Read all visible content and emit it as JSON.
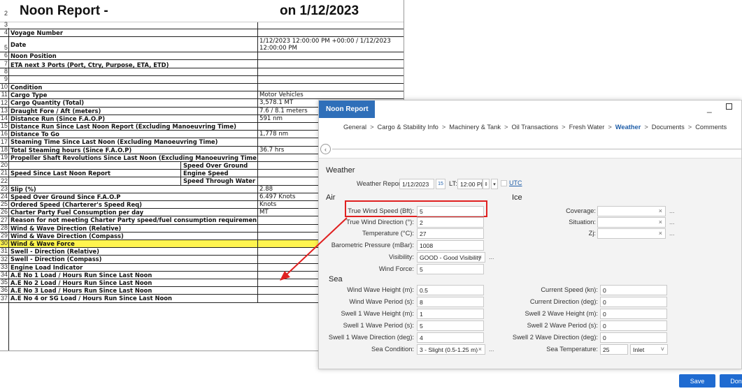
{
  "sheet": {
    "title_left": "Noon Report -",
    "title_right": "on 1/12/2023",
    "rows": [
      {
        "n": "3",
        "label": "",
        "value": ""
      },
      {
        "n": "4",
        "label": "Voyage Number",
        "value": ""
      },
      {
        "n": "5",
        "label": "Date",
        "value": "1/12/2023 12:00:00 PM +00:00 / 1/12/2023 12:00:00 PM"
      },
      {
        "n": "6",
        "label": "Noon Position",
        "value": ""
      },
      {
        "n": "7",
        "label": "ETA next 3 Ports (Port, Ctry, Purpose, ETA, ETD)",
        "value": ""
      },
      {
        "n": "8",
        "label": "",
        "value": ""
      },
      {
        "n": "9",
        "label": "",
        "value": ""
      },
      {
        "n": "10",
        "label": "Condition",
        "value": ""
      },
      {
        "n": "11",
        "label": "Cargo Type",
        "value": "Motor Vehicles"
      },
      {
        "n": "12",
        "label": "Cargo Quantity (Total)",
        "value": "3,578.1 MT"
      },
      {
        "n": "13",
        "label": "Draught Fore / Aft (meters)",
        "value": "7.6 / 8.1 meters"
      },
      {
        "n": "14",
        "label": "Distance Run (Since F.A.O.P)",
        "value": "591 nm"
      },
      {
        "n": "15",
        "label": "Distance Run Since Last Noon Report (Excluding Manoeuvring Time)",
        "value": ""
      },
      {
        "n": "16",
        "label": "Distance To Go",
        "value": "1,778 nm"
      },
      {
        "n": "17",
        "label": "Steaming Time Since Last Noon (Excluding Manoeuvring Time)",
        "value": ""
      },
      {
        "n": "18",
        "label": "Total Steaming hours (Since F.A.O.P)",
        "value": "36.7 hrs"
      },
      {
        "n": "19",
        "label": "Propeller Shaft Revolutions Since Last Noon (Excluding Manoeuvring Time)",
        "value": ""
      },
      {
        "n": "20",
        "label": "",
        "sub": "Speed Over Ground",
        "value": ""
      },
      {
        "n": "21",
        "label": "Speed Since Last Noon Report",
        "sub": "Engine Speed",
        "value": ""
      },
      {
        "n": "22",
        "label": "",
        "sub": "Speed Through Water",
        "value": ""
      },
      {
        "n": "23",
        "label": "Slip (%)",
        "value": "2.88"
      },
      {
        "n": "24",
        "label": "Speed Over Ground Since F.A.O.P",
        "value": "6.497 Knots"
      },
      {
        "n": "25",
        "label": "Ordered Speed (Charterer's Speed Req)",
        "value": "Knots"
      },
      {
        "n": "26",
        "label": "Charter Party Fuel Consumption per day",
        "value": "MT"
      },
      {
        "n": "27",
        "label": "Reason for not meeting Charter Party speed/fuel consumption requirements",
        "value": ""
      },
      {
        "n": "28",
        "label": "Wind & Wave Direction (Relative)",
        "value": ""
      },
      {
        "n": "29",
        "label": "Wind & Wave Direction (Compass)",
        "value": ""
      },
      {
        "n": "30",
        "label": "Wind & Wave Force",
        "value": "",
        "highlight": true
      },
      {
        "n": "31",
        "label": "Swell - Direction (Relative)",
        "value": ""
      },
      {
        "n": "32",
        "label": "Swell - Direction (Compass)",
        "value": ""
      },
      {
        "n": "33",
        "label": "Engine Load Indicator",
        "value": ""
      },
      {
        "n": "34",
        "label": "A.E No 1 Load / Hours Run Since Last Noon",
        "value": ""
      },
      {
        "n": "35",
        "label": "A.E No 2 Load / Hours Run Since Last Noon",
        "value": ""
      },
      {
        "n": "36",
        "label": "A.E No 3 Load / Hours Run Since Last Noon",
        "value": ""
      },
      {
        "n": "37",
        "label": "A.E No 4 or SG Load / Hours Run Since Last Noon",
        "value": ""
      }
    ],
    "row2_number": "2"
  },
  "dialog": {
    "title": "Noon Report",
    "nav": [
      "General",
      "Cargo & Stability Info",
      "Machinery & Tank",
      "Oil Transactions",
      "Fresh Water",
      "Weather",
      "Documents",
      "Comments"
    ],
    "nav_sep": ">",
    "active_tab": "Weather",
    "section_weather": "Weather",
    "weather_report_label": "Weather Report:",
    "weather_report_date": "1/12/2023",
    "calendar_icon_text": "15",
    "lt_label": "LT:",
    "lt_time": "12:00 PM",
    "utc_label": "UTC",
    "section_air": "Air",
    "section_ice": "Ice",
    "section_sea": "Sea",
    "air_fields": [
      {
        "label": "True Wind Speed (Bft):",
        "value": "5"
      },
      {
        "label": "True Wind Direction (°):",
        "value": "2"
      },
      {
        "label": "Temperature (°C):",
        "value": "27"
      },
      {
        "label": "Barometric Pressure (mBar):",
        "value": "1008"
      },
      {
        "label": "Visibility:",
        "value": "GOOD - Good Visibility"
      },
      {
        "label": "Wind Force:",
        "value": "5"
      }
    ],
    "ice_fields": [
      {
        "label": "Coverage:",
        "value": ""
      },
      {
        "label": "Situation:",
        "value": ""
      },
      {
        "label": "Zj:",
        "value": ""
      }
    ],
    "sea_left": [
      {
        "label": "Wind Wave Height (m):",
        "value": "0.5"
      },
      {
        "label": "Wind Wave Period (s):",
        "value": "8"
      },
      {
        "label": "Swell 1 Wave Height (m):",
        "value": "1"
      },
      {
        "label": "Swell 1 Wave Period (s):",
        "value": "5"
      },
      {
        "label": "Swell 1 Wave Direction (deg):",
        "value": "4"
      },
      {
        "label": "Sea Condition:",
        "value": "3 - Slight (0.5-1.25 m)"
      }
    ],
    "sea_right": [
      {
        "label": "Current Speed (kn):",
        "value": "0"
      },
      {
        "label": "Current Direction (deg):",
        "value": "0"
      },
      {
        "label": "Swell 2 Wave Height (m):",
        "value": "0"
      },
      {
        "label": "Swell 2 Wave Period (s):",
        "value": "0"
      },
      {
        "label": "Swell 2 Wave Direction (deg):",
        "value": "0"
      },
      {
        "label": "Sea Temperature:",
        "value": "25"
      }
    ],
    "sea_temp_unit": "Inlet",
    "clear_glyph": "×",
    "ellipsis": "...",
    "save_label": "Save",
    "done_label": "Done"
  }
}
